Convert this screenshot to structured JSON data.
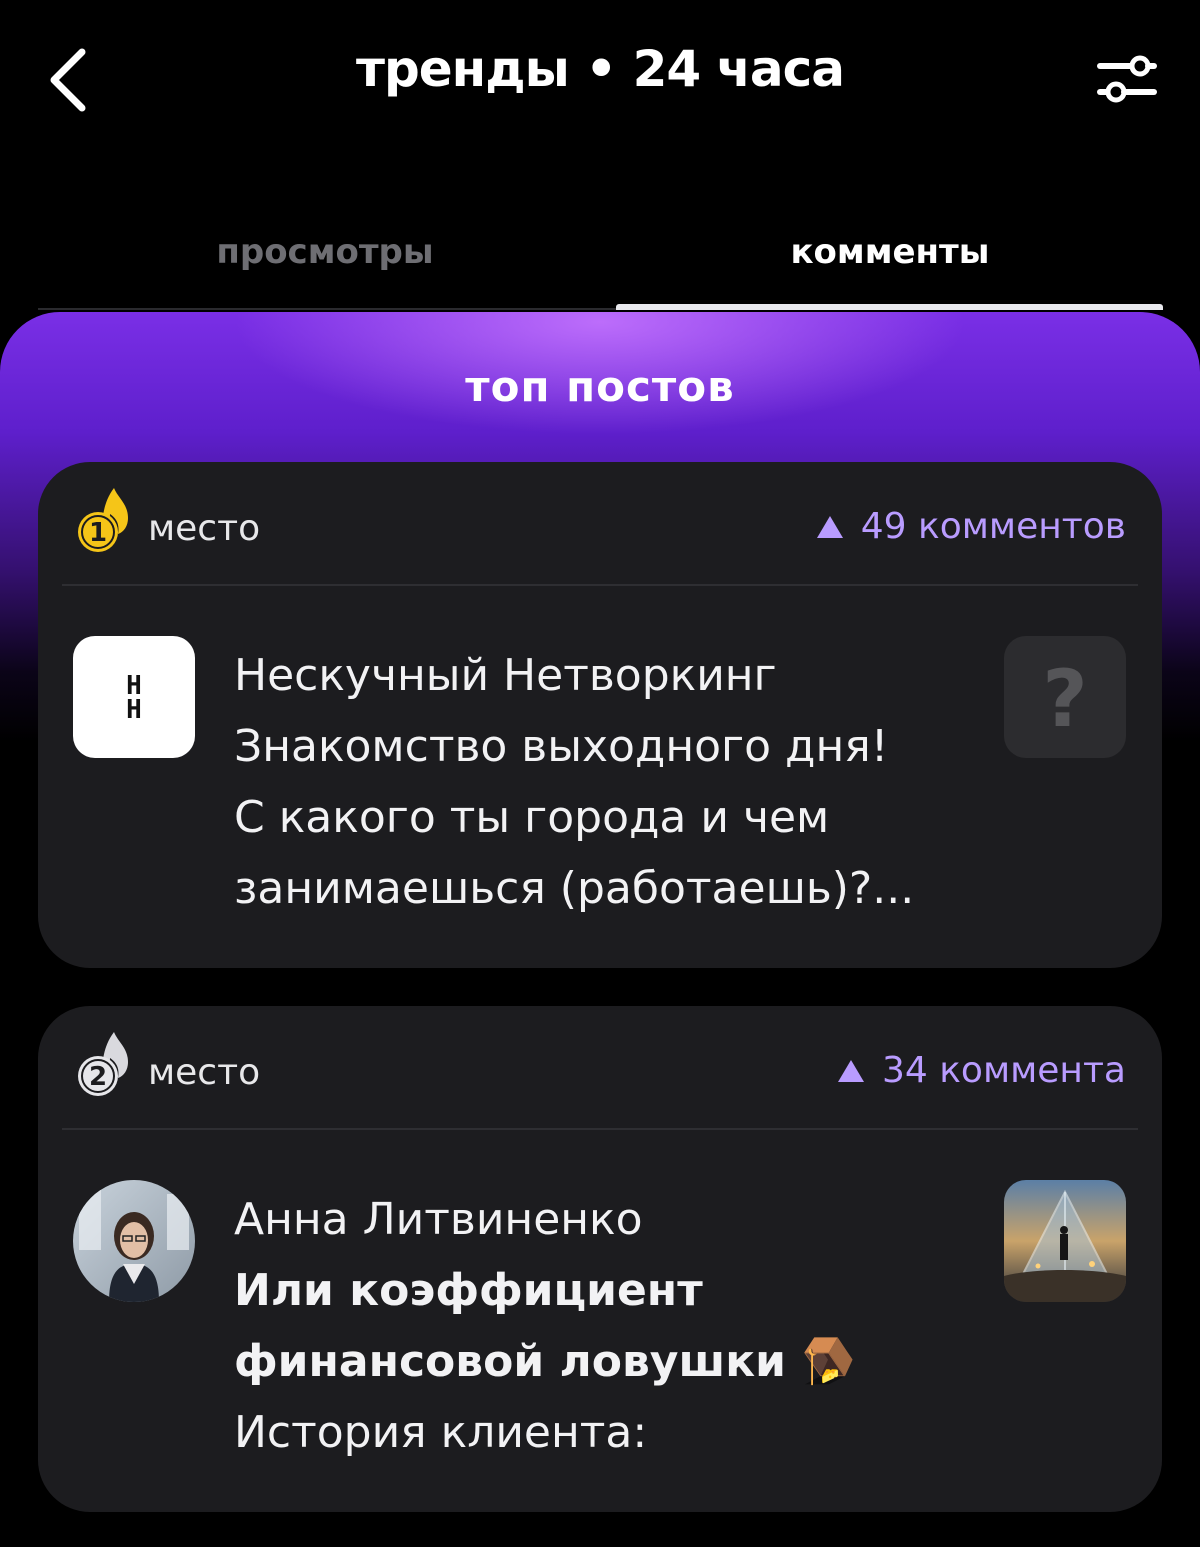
{
  "header": {
    "title": "тренды • 24 часа",
    "back_icon": "chevron-left-icon",
    "filter_icon": "sliders-icon"
  },
  "tabs": [
    {
      "label": "просмотры",
      "active": false
    },
    {
      "label": "комменты",
      "active": true
    }
  ],
  "panel": {
    "title": "топ постов"
  },
  "posts": [
    {
      "rank": "1",
      "rank_label": "место",
      "comments": "49 комментов",
      "avatar_text": "Н\nН",
      "lines": [
        "Нескучный Нетворкинг",
        "Знакомство выходного дня!",
        "С какого ты города и чем",
        "занимаешься (работаешь)?..."
      ],
      "thumb_text": "?"
    },
    {
      "rank": "2",
      "rank_label": "место",
      "comments": "34 коммента",
      "author": "Анна Литвиненко",
      "lines": [
        "Или коэффициент",
        "финансовой ловушки 🪤",
        "История клиента:"
      ]
    }
  ],
  "colors": {
    "accent": "#b99cff",
    "gold": "#f5c518",
    "card": "#1c1c1f",
    "panel_gradient_top": "#7a2fe6"
  }
}
